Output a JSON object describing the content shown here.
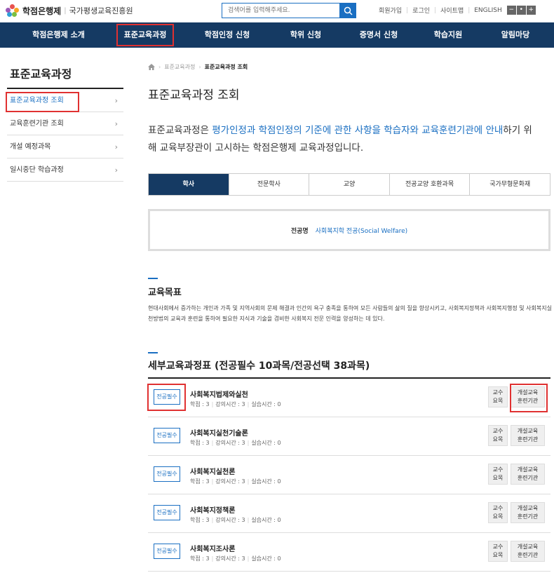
{
  "header": {
    "logo_text": "학점은행제",
    "logo_sub": "국가평생교육진흥원",
    "search_placeholder": "검색어를 입력해주세요.",
    "links": [
      "회원가입",
      "로그인",
      "사이트맵",
      "ENGLISH"
    ],
    "font_buttons": [
      "−",
      "•",
      "+"
    ]
  },
  "nav": {
    "items": [
      "학점은행제 소개",
      "표준교육과정",
      "학점인정 신청",
      "학위 신청",
      "증명서 신청",
      "학습지원",
      "알림마당"
    ],
    "active_index": 1
  },
  "sidebar": {
    "title": "표준교육과정",
    "items": [
      "표준교육과정 조회",
      "교육훈련기관 조회",
      "개설 예정과목",
      "일시중단 학습과정"
    ],
    "active_index": 0
  },
  "breadcrumb": [
    "표준교육과정",
    "표준교육과정 조회"
  ],
  "page_title": "표준교육과정 조회",
  "intro": {
    "p1": "표준교육과정은 ",
    "h1": "평가인정과 학점인정의 기준에 관한 사항을 학습자와 교육훈련기관에 안내",
    "p2": "하기 위해 교육부장관이 고시하는 학점은행제 교육과정입니다."
  },
  "tabs": [
    "학사",
    "전문학사",
    "교양",
    "전공교양 호환과목",
    "국가무형문화재"
  ],
  "active_tab": 0,
  "major": {
    "label": "전공명",
    "value": "사회복지학 전공(Social Welfare)"
  },
  "goal": {
    "title": "교육목표",
    "text": "현대사회에서 증가하는 개인과 가족 및 지역사회의 문제 해결과 인간의 욕구 충족을 통하여 모든 사람들의 삶의 질을 향상시키고, 사회복지정책과 사회복지행정 및 사회복지실천방법의 교육과 훈련을 통하여 필요한 지식과 기술을 겸비한 사회복지 전문 인력을 양성하는 데 있다."
  },
  "curriculum": {
    "title": "세부교육과정표 (전공필수 10과목/전공선택 38과목)",
    "btn1": [
      "교수",
      "요목"
    ],
    "btn2": [
      "개설교육",
      "훈련기관"
    ],
    "courses": [
      {
        "badge": "전공필수",
        "name": "사회복지법제와실천",
        "credit": "학점 : 3",
        "lecture": "강의시간 : 3",
        "practice": "실습시간 : 0"
      },
      {
        "badge": "전공필수",
        "name": "사회복지실천기술론",
        "credit": "학점 : 3",
        "lecture": "강의시간 : 3",
        "practice": "실습시간 : 0"
      },
      {
        "badge": "전공필수",
        "name": "사회복지실천론",
        "credit": "학점 : 3",
        "lecture": "강의시간 : 3",
        "practice": "실습시간 : 0"
      },
      {
        "badge": "전공필수",
        "name": "사회복지정책론",
        "credit": "학점 : 3",
        "lecture": "강의시간 : 3",
        "practice": "실습시간 : 0"
      },
      {
        "badge": "전공필수",
        "name": "사회복지조사론",
        "credit": "학점 : 3",
        "lecture": "강의시간 : 3",
        "practice": "실습시간 : 0"
      }
    ]
  },
  "colors": {
    "nav_bg": "#153a63",
    "accent": "#1a6fc2",
    "highlight_box": "#e03131"
  }
}
